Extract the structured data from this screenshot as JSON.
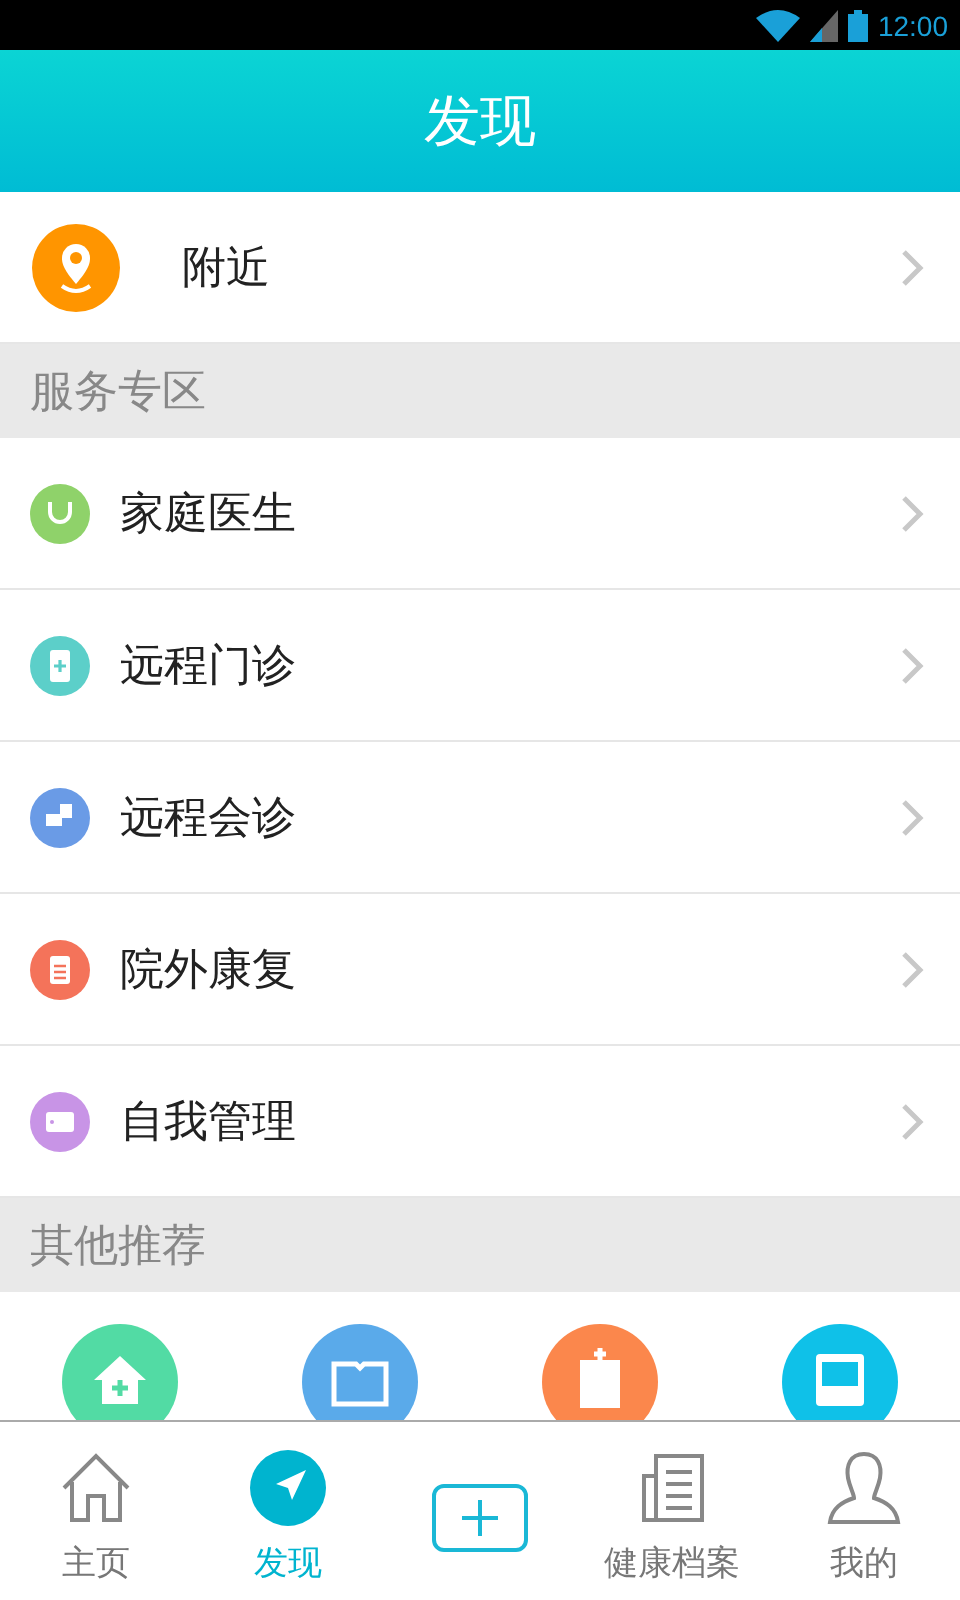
{
  "status_bar": {
    "time": "12:00"
  },
  "header": {
    "title": "发现"
  },
  "nearby": {
    "label": "附近"
  },
  "sections": [
    {
      "title": "服务专区",
      "items": [
        {
          "label": "家庭医生",
          "color": "#8fd26a"
        },
        {
          "label": "远程门诊",
          "color": "#5ccfc9"
        },
        {
          "label": "远程会诊",
          "color": "#6a9be6"
        },
        {
          "label": "院外康复",
          "color": "#f4735a"
        },
        {
          "label": "自我管理",
          "color": "#c894e6"
        }
      ]
    },
    {
      "title": "其他推荐"
    }
  ],
  "recommend": [
    {
      "color": "#52dba4"
    },
    {
      "color": "#5aaaea"
    },
    {
      "color": "#fb874c"
    },
    {
      "color": "#0fc1e8"
    }
  ],
  "tabs": [
    {
      "kind": "home",
      "label": "主页",
      "selected": false
    },
    {
      "kind": "discover",
      "label": "发现",
      "selected": true
    },
    {
      "kind": "add",
      "selected": false
    },
    {
      "kind": "records",
      "label": "健康档案",
      "selected": false
    },
    {
      "kind": "me",
      "label": "我的",
      "selected": false
    }
  ]
}
